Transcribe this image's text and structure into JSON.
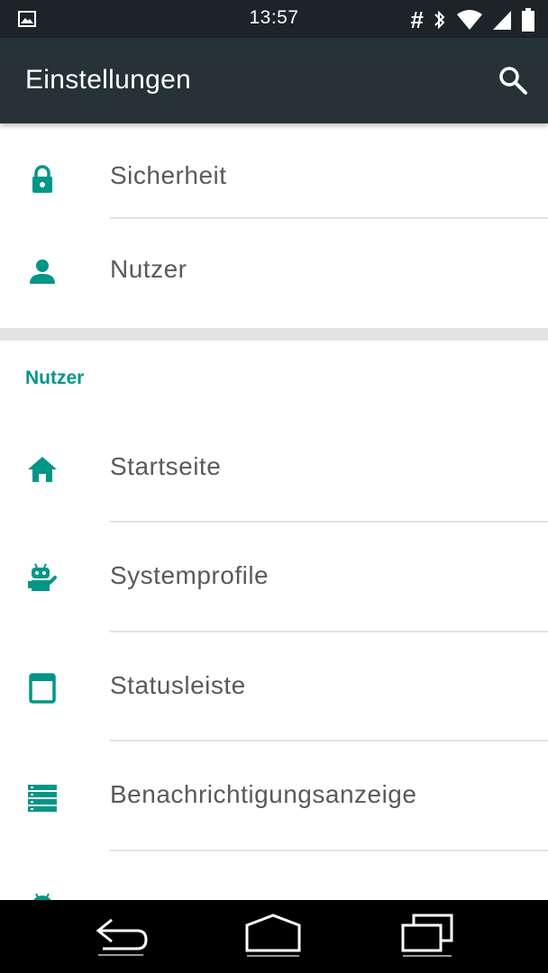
{
  "status_bar": {
    "time": "13:57",
    "left_icon": "image-notification-icon",
    "extra_glyph": "#",
    "icons": [
      "hash-icon",
      "bluetooth-icon",
      "wifi-icon",
      "cell-signal-icon",
      "battery-icon"
    ]
  },
  "app_bar": {
    "title": "Einstellungen",
    "search_icon": "search-icon"
  },
  "top_items": [
    {
      "label": "Sicherheit",
      "icon": "lock-icon"
    },
    {
      "label": "Nutzer",
      "icon": "person-icon"
    }
  ],
  "section": {
    "header": "Nutzer",
    "items": [
      {
        "label": "Startseite",
        "icon": "home-icon"
      },
      {
        "label": "Systemprofile",
        "icon": "cyanogen-robot-icon"
      },
      {
        "label": "Statusleiste",
        "icon": "statusbar-icon"
      },
      {
        "label": "Benachrichtigungsanzeige",
        "icon": "notification-drawer-icon"
      },
      {
        "label": "",
        "icon": "android-icon"
      }
    ]
  },
  "nav_bar": {
    "buttons": [
      "back-icon",
      "home-icon",
      "recents-icon"
    ]
  },
  "colors": {
    "accent": "#009688",
    "app_bar": "#263238",
    "status_bar": "#1d2327",
    "text": "#5a5a5a"
  }
}
